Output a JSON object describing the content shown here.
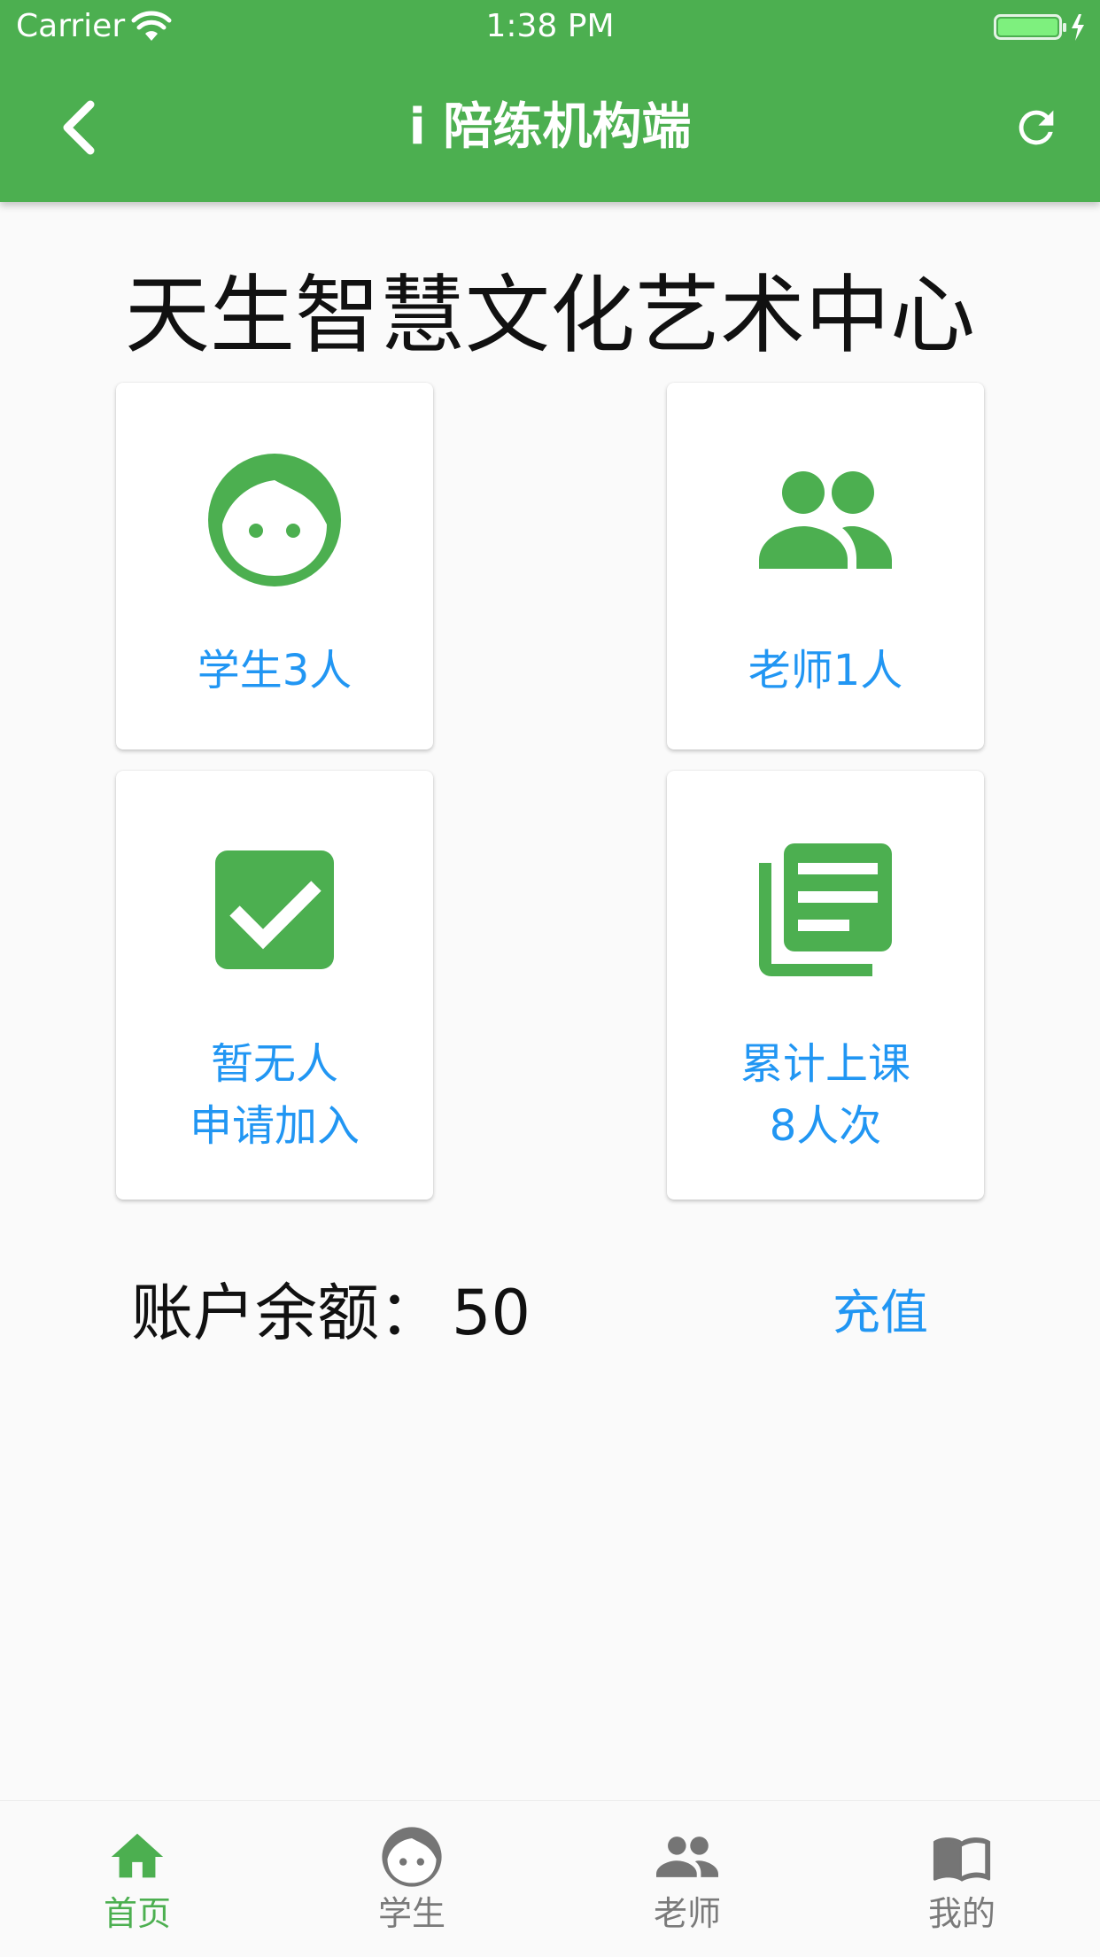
{
  "status_bar": {
    "carrier": "Carrier",
    "time": "1:38 PM"
  },
  "header": {
    "title": "i 陪练机构端",
    "back_icon": "chevron-left-icon",
    "refresh_icon": "refresh-icon"
  },
  "organization": {
    "name": "天生智慧文化艺术中心"
  },
  "cards": [
    {
      "icon": "student-face-icon",
      "lines": [
        "学生3人"
      ]
    },
    {
      "icon": "people-icon",
      "lines": [
        "老师1人"
      ]
    },
    {
      "icon": "checkbox-icon",
      "lines": [
        "暂无人",
        "申请加入"
      ]
    },
    {
      "icon": "library-books-icon",
      "lines": [
        "累计上课",
        "8人次"
      ]
    }
  ],
  "balance": {
    "label": "账户余额：",
    "value": "50",
    "recharge_label": "充值"
  },
  "tab_bar": {
    "items": [
      {
        "label": "首页",
        "icon": "home-icon",
        "active": true
      },
      {
        "label": "学生",
        "icon": "face-icon",
        "active": false
      },
      {
        "label": "老师",
        "icon": "people-icon",
        "active": false
      },
      {
        "label": "我的",
        "icon": "book-icon",
        "active": false
      }
    ]
  },
  "colors": {
    "primary": "#4caf50",
    "accent_text": "#2196f3",
    "inactive_tab": "#7a7a7a",
    "background": "#fafafa"
  }
}
